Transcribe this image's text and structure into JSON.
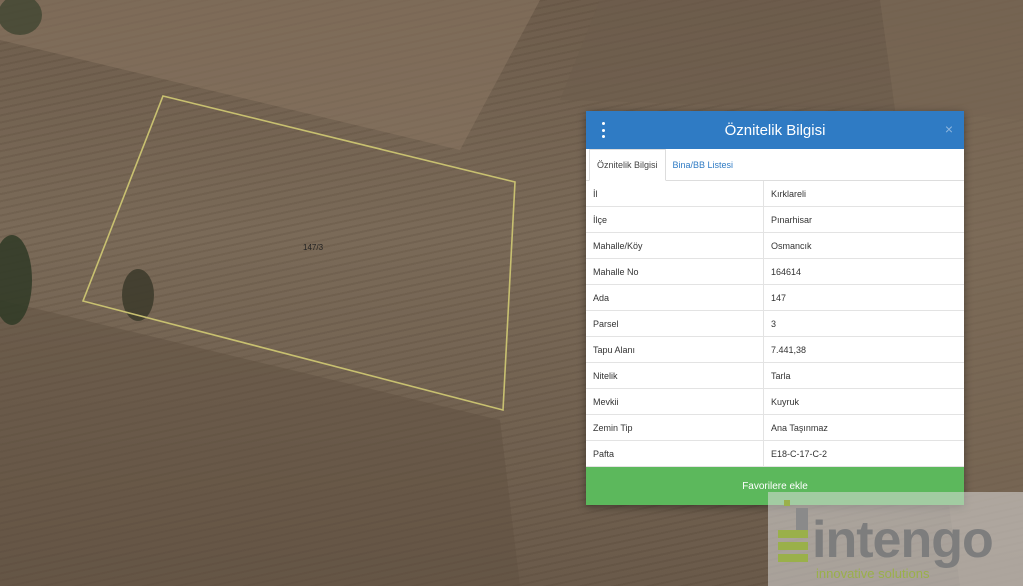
{
  "map": {
    "parcel_label": "147/3"
  },
  "panel": {
    "title": "Öznitelik Bilgisi",
    "close_glyph": "×",
    "tabs": [
      {
        "label": "Öznitelik Bilgisi",
        "active": true
      },
      {
        "label": "Bina/BB Listesi",
        "active": false
      }
    ],
    "rows": [
      {
        "key": "İl",
        "value": "Kırklareli"
      },
      {
        "key": "İlçe",
        "value": "Pınarhisar"
      },
      {
        "key": "Mahalle/Köy",
        "value": "Osmancık"
      },
      {
        "key": "Mahalle No",
        "value": "164614"
      },
      {
        "key": "Ada",
        "value": "147"
      },
      {
        "key": "Parsel",
        "value": "3"
      },
      {
        "key": "Tapu Alanı",
        "value": "7.441,38"
      },
      {
        "key": "Nitelik",
        "value": "Tarla"
      },
      {
        "key": "Mevkii",
        "value": "Kuyruk"
      },
      {
        "key": "Zemin Tip",
        "value": "Ana Taşınmaz"
      },
      {
        "key": "Pafta",
        "value": "E18-C-17-C-2"
      }
    ],
    "favorite_button": "Favorilere ekle"
  },
  "logo": {
    "text": "intengo",
    "tagline": "innovative solutions"
  },
  "colors": {
    "header": "#2f7bc4",
    "button": "#5cb85c",
    "parcel_outline": "#c8c070"
  }
}
